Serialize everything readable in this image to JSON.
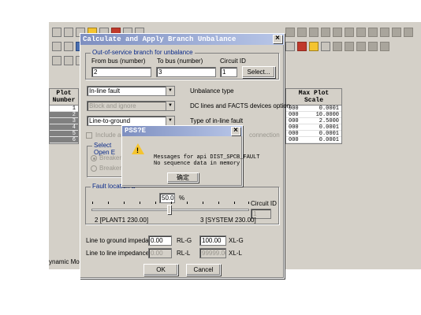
{
  "background_app": {
    "left_grid": {
      "header": [
        "Plot",
        "Number"
      ],
      "rows": [
        "1",
        "2",
        "3",
        "4",
        "5",
        "6"
      ]
    },
    "right_grid": {
      "header": [
        "Max Plot",
        "Scale"
      ],
      "rows": [
        {
          "prefix": "000",
          "value": "0.0001"
        },
        {
          "prefix": "000",
          "value": "10.0000"
        },
        {
          "prefix": "000",
          "value": "2.5000"
        },
        {
          "prefix": "000",
          "value": "0.0001"
        },
        {
          "prefix": "000",
          "value": "0.0001"
        },
        {
          "prefix": "000",
          "value": "0.0001"
        }
      ]
    },
    "dynamic_models_label": "ynamic Models"
  },
  "dialog": {
    "title": "Calculate and Apply Branch Unbalance",
    "close_label": "×",
    "oos_group_label": "Out-of-service branch for unbalance",
    "from_bus_label": "From bus (number)",
    "to_bus_label": "To bus (number)",
    "circuit_id_label": "Circuit ID",
    "from_bus_value": "2",
    "to_bus_value": "3",
    "circuit_id_value": "1",
    "select_label": "Select...",
    "unbalance_type_value": "In-line fault",
    "unbalance_type_label": "Unbalance type",
    "dc_option_value": "Block and ignore",
    "dc_option_label": "DC lines and FACTS devices option",
    "inline_fault_type_value": "Line-to-ground",
    "inline_fault_type_label": "Type of in-line fault",
    "include_path_label": "Include a path",
    "connection_label": "connection",
    "select_open_end_label": "Select Open E",
    "breaker_1_label": "Breaker at F",
    "breaker_2_label": "Breaker at T",
    "fault_location_label": "Fault location a",
    "fault_location_value": "50.00",
    "percent_label": "%",
    "circuit_id_label_2": "Circuit ID",
    "circuit_id_value_2": "1",
    "from_bus_name": "2 [PLANT1      230.00]",
    "to_bus_name": "3 [SYSTEM      230.00]",
    "slider_fraction": 0.5,
    "line_to_ground_label": "Line to ground impedance",
    "ltg_r_value": "0.00",
    "ltg_r_label": "RL-G",
    "ltg_x_value": "100.00",
    "ltg_x_label": "XL-G",
    "line_to_line_label": "Line to line impedance",
    "ltl_r_value": "0.00",
    "ltl_r_label": "RL-L",
    "ltl_x_value": "99999.00",
    "ltl_x_label": "XL-L",
    "ok_label": "OK",
    "cancel_label": "Cancel"
  },
  "message_box": {
    "title": "PSS?E",
    "close_label": "×",
    "text": "Messages for api DIST_SPCB_FAULT\nNo sequence data in memory",
    "ok_label": "确定"
  }
}
